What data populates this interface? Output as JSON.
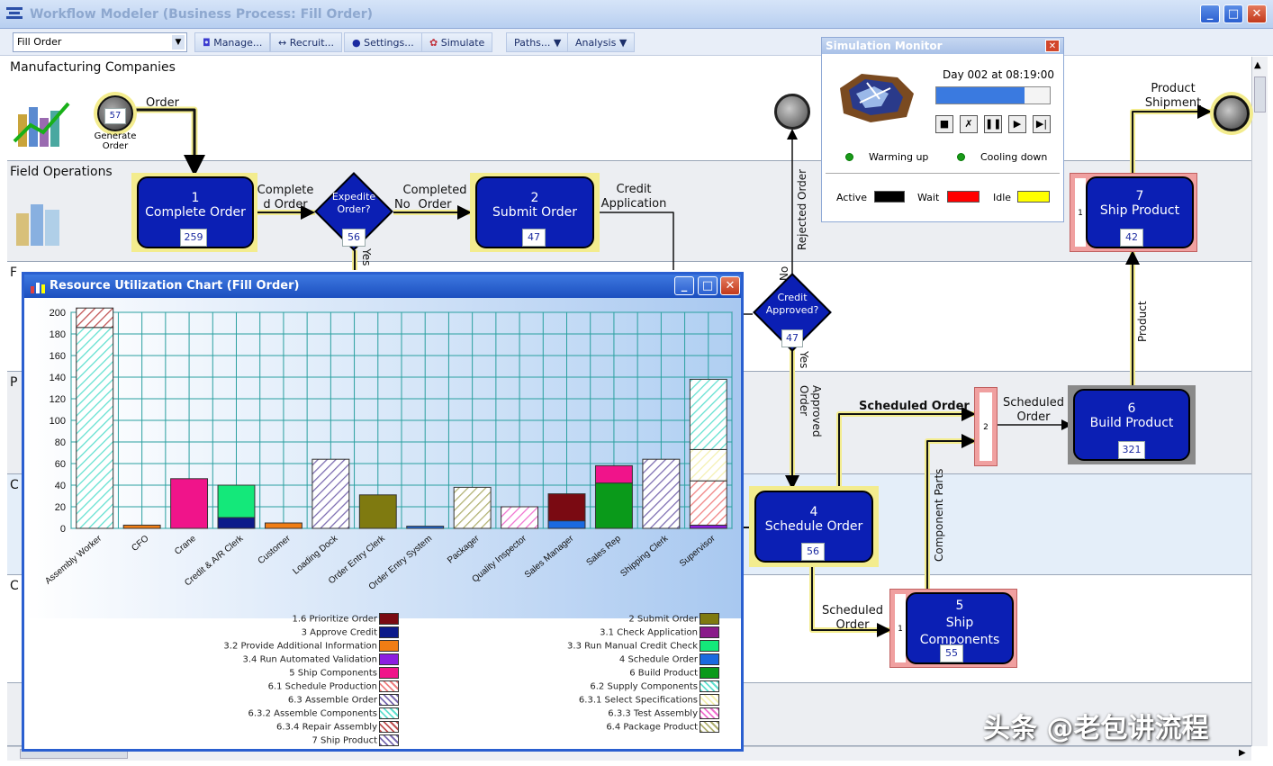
{
  "window": {
    "title": "Workflow Modeler (Business Process: Fill Order)"
  },
  "toolbar": {
    "process_value": "Fill Order",
    "manage": "Manage...",
    "recruit": "Recruit...",
    "settings": "Settings...",
    "simulate": "Simulate",
    "paths": "Paths...",
    "analysis": "Analysis"
  },
  "lanes": [
    {
      "label": "Manufacturing Companies"
    },
    {
      "label": "Field Operations"
    },
    {
      "label": "F"
    },
    {
      "label": "P"
    },
    {
      "label": "C"
    },
    {
      "label": "C"
    }
  ],
  "nodes": {
    "generate": {
      "count": "57",
      "label": "Generate Order"
    },
    "complete": {
      "num": "1",
      "name": "Complete Order",
      "count": "259"
    },
    "expedite": {
      "name": "Expedite Order?",
      "count": "56"
    },
    "submit": {
      "num": "2",
      "name": "Submit Order",
      "count": "47"
    },
    "credit": {
      "name": "Credit Approved?",
      "count": "47"
    },
    "schedule": {
      "num": "4",
      "name": "Schedule Order",
      "count": "56"
    },
    "ship_comp": {
      "num": "5",
      "name": "Ship Components",
      "count": "55"
    },
    "build": {
      "num": "6",
      "name": "Build Product",
      "count": "321"
    },
    "ship_prod": {
      "num": "7",
      "name": "Ship Product",
      "count": "42"
    },
    "join_small": "2",
    "side_small_5": "1",
    "side_small_7": "1"
  },
  "flows": {
    "order": "Order",
    "completed_order_1": "Complete d Order",
    "no": "No",
    "completed_order_2": "Completed Order",
    "credit_application": "Credit Application",
    "yes": "Yes",
    "rejected_order": "Rejected Order",
    "no2": "No",
    "yes2": "Yes",
    "approved_order": "Approved Order",
    "scheduled_order_1": "Scheduled Order",
    "scheduled_order_2": "Scheduled Order",
    "scheduled_order_3": "Scheduled Order",
    "component_parts": "Component Parts",
    "product": "Product",
    "product_shipment": "Product Shipment"
  },
  "sim": {
    "title": "Simulation Monitor",
    "time": "Day 002 at 08:19:00",
    "progress": 0.78,
    "warming": "Warming up",
    "cooling": "Cooling down",
    "active": "Active",
    "wait": "Wait",
    "idle": "Idle",
    "colors": {
      "active": "#000000",
      "wait": "#ff0000",
      "idle": "#ffff00"
    }
  },
  "chart_window": {
    "title": "Resource Utilization Chart (Fill Order)"
  },
  "chart_data": {
    "type": "bar",
    "stacked": true,
    "ylim": [
      0,
      200
    ],
    "yticks": [
      0,
      20,
      40,
      60,
      80,
      100,
      120,
      140,
      160,
      180,
      200
    ],
    "categories": [
      "Assembly Worker",
      "CFO",
      "Crane",
      "Credit & A/R Clerk",
      "Customer",
      "Loading Dock",
      "Order Entry Clerk",
      "Order Entry System",
      "Packager",
      "Quality Inspector",
      "Sales Manager",
      "Sales Rep",
      "Shipping Clerk",
      "Supervisor"
    ],
    "stacks": [
      [
        {
          "task": "6.3.2 Assemble Components",
          "value": 186
        },
        {
          "task": "6.3.4 Repair Assembly",
          "value": 18
        }
      ],
      [
        {
          "task": "3.2 Provide Additional Information",
          "value": 3
        }
      ],
      [
        {
          "task": "5 Ship Components",
          "value": 46
        }
      ],
      [
        {
          "task": "3 Approve Credit",
          "value": 10
        },
        {
          "task": "3.3 Run Manual Credit Check",
          "value": 30
        }
      ],
      [
        {
          "task": "3.2 Provide Additional Information",
          "value": 5
        }
      ],
      [
        {
          "task": "6.3 Assemble Order",
          "value": 64
        }
      ],
      [
        {
          "task": "2 Submit Order",
          "value": 31
        }
      ],
      [
        {
          "task": "4 Schedule Order",
          "value": 2
        }
      ],
      [
        {
          "task": "6.4 Package Product",
          "value": 38
        }
      ],
      [
        {
          "task": "6.3.3 Test Assembly",
          "value": 20
        }
      ],
      [
        {
          "task": "4 Schedule Order",
          "value": 7
        },
        {
          "task": "1.6 Prioritize Order",
          "value": 25
        }
      ],
      [
        {
          "task": "6 Build Product",
          "value": 42
        },
        {
          "task": "5 Ship Components",
          "value": 16
        }
      ],
      [
        {
          "task": "6.3 Assemble Order",
          "value": 64
        }
      ],
      [
        {
          "task": "3.4 Run Automated Validation",
          "value": 3
        },
        {
          "task": "6.1 Schedule Production",
          "value": 41
        },
        {
          "task": "6.3.1 Select Specifications",
          "value": 29
        },
        {
          "task": "6.2 Supply Components",
          "value": 65
        }
      ]
    ],
    "legend_left": [
      "1.6 Prioritize Order",
      "3 Approve Credit",
      "3.2 Provide Additional Information",
      "3.4 Run Automated Validation",
      "5 Ship Components",
      "6.1 Schedule Production",
      "6.3 Assemble Order",
      "6.3.2 Assemble Components",
      "6.3.4 Repair Assembly",
      "7 Ship Product"
    ],
    "legend_right": [
      "2 Submit Order",
      "3.1 Check Application",
      "3.3 Run Manual Credit Check",
      "4 Schedule Order",
      "6 Build Product",
      "6.2 Supply Components",
      "6.3.1 Select Specifications",
      "6.3.3 Test Assembly",
      "6.4 Package Product"
    ],
    "task_styles": {
      "1.6 Prioritize Order": {
        "color": "#7a0a12",
        "hatch": false
      },
      "2 Submit Order": {
        "color": "#7f7a10",
        "hatch": false
      },
      "3 Approve Credit": {
        "color": "#0c1a8a",
        "hatch": false
      },
      "3.1 Check Application": {
        "color": "#8a1a8a",
        "hatch": false
      },
      "3.2 Provide Additional Information": {
        "color": "#f07d14",
        "hatch": false
      },
      "3.3 Run Manual Credit Check": {
        "color": "#14e87a",
        "hatch": false
      },
      "3.4 Run Automated Validation": {
        "color": "#8c1ee0",
        "hatch": false
      },
      "4 Schedule Order": {
        "color": "#1a6ae0",
        "hatch": false
      },
      "5 Ship Components": {
        "color": "#f0148a",
        "hatch": false
      },
      "6 Build Product": {
        "color": "#0a9a1a",
        "hatch": false
      },
      "6.1 Schedule Production": {
        "color": "#f08080",
        "hatch": true
      },
      "6.2 Supply Components": {
        "color": "#60e0d0",
        "hatch": true
      },
      "6.3 Assemble Order": {
        "color": "#7a6ab0",
        "hatch": true
      },
      "6.3.1 Select Specifications": {
        "color": "#f4f0b0",
        "hatch": true
      },
      "6.3.2 Assemble Components": {
        "color": "#60e0d0",
        "hatch": true
      },
      "6.3.3 Test Assembly": {
        "color": "#f070d0",
        "hatch": true
      },
      "6.3.4 Repair Assembly": {
        "color": "#c05050",
        "hatch": true
      },
      "6.4 Package Product": {
        "color": "#b0b070",
        "hatch": true
      },
      "7 Ship Product": {
        "color": "#7a6ab0",
        "hatch": true
      }
    }
  },
  "watermark": "头条 @老包讲流程"
}
